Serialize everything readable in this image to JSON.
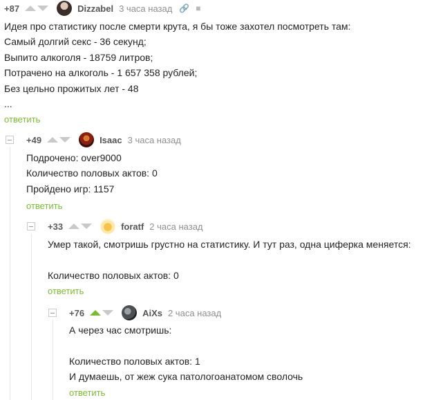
{
  "comments": [
    {
      "rating": "+87",
      "author": "Dizzabel",
      "time": "3 часа назад",
      "lines": [
        "Идея про статистику после смерти крута, я бы тоже захотел посмотреть там:",
        "Самый долгий секс - 36 секунд;",
        "Выпито алкоголя - 18759 литров;",
        "Потрачено на алкоголь - 1 657 358 рублей;",
        "Без цельно прожитых лет - 48",
        "..."
      ],
      "reply": "ответить",
      "icons": [
        "link-icon",
        "save-icon"
      ]
    },
    {
      "rating": "+49",
      "author": "Isaac",
      "time": "3 часа назад",
      "lines": [
        "Подрочено: over9000",
        "Количество половых актов: 0",
        "Пройдено игр: 1157"
      ],
      "reply": "ответить"
    },
    {
      "rating": "+33",
      "author": "foratf",
      "time": "2 часа назад",
      "lines": [
        "Умер такой, смотришь грустно на статистику. И тут раз, одна циферка меняется:",
        "",
        "Количество половых актов: 0"
      ],
      "reply": "ответить"
    },
    {
      "rating": "+76",
      "author": "AiXs",
      "time": "2 часа назад",
      "lines": [
        "А через час смотришь:",
        "",
        "Количество половых актов: 1",
        "И думаешь, от жеж сука патологоанатомом сволочь"
      ],
      "reply": "ответить",
      "upvoted": true
    }
  ],
  "colors": {
    "accent": "#79bd2f",
    "arrow": "#c9c9c9",
    "time": "#8f8f8f"
  }
}
